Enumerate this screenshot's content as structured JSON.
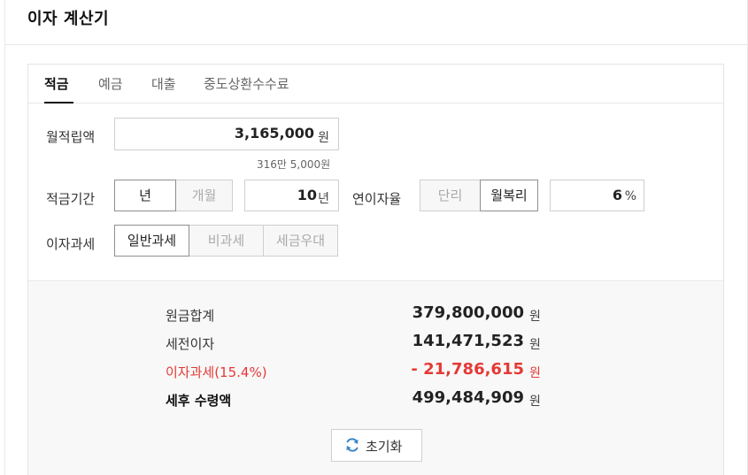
{
  "title": "이자 계산기",
  "tabs": [
    {
      "label": "적금",
      "active": true
    },
    {
      "label": "예금",
      "active": false
    },
    {
      "label": "대출",
      "active": false
    },
    {
      "label": "중도상환수수료",
      "active": false
    }
  ],
  "form": {
    "monthly": {
      "label": "월적립액",
      "value": "3,165,000",
      "unit": "원",
      "hint": "316만 5,000원"
    },
    "period": {
      "label": "적금기간",
      "options": [
        "년",
        "개월"
      ],
      "selected": "년",
      "value": "10",
      "unit": "년"
    },
    "rate": {
      "label": "연이자율",
      "options": [
        "단리",
        "월복리"
      ],
      "selected": "월복리",
      "value": "6",
      "unit": "%"
    },
    "tax": {
      "label": "이자과세",
      "options": [
        "일반과세",
        "비과세",
        "세금우대"
      ],
      "selected": "일반과세"
    }
  },
  "results": {
    "principal": {
      "label": "원금합계",
      "value": "379,800,000",
      "unit": "원"
    },
    "interest": {
      "label": "세전이자",
      "value": "141,471,523",
      "unit": "원"
    },
    "tax": {
      "label": "이자과세(15.4%)",
      "value": "- 21,786,615",
      "unit": "원"
    },
    "after_tax": {
      "label": "세후 수령액",
      "value": "499,484,909",
      "unit": "원"
    }
  },
  "reset": {
    "label": "초기화",
    "icon": "refresh-icon"
  },
  "colors": {
    "red": "#e53935",
    "accent_blue": "#3a86c8"
  }
}
